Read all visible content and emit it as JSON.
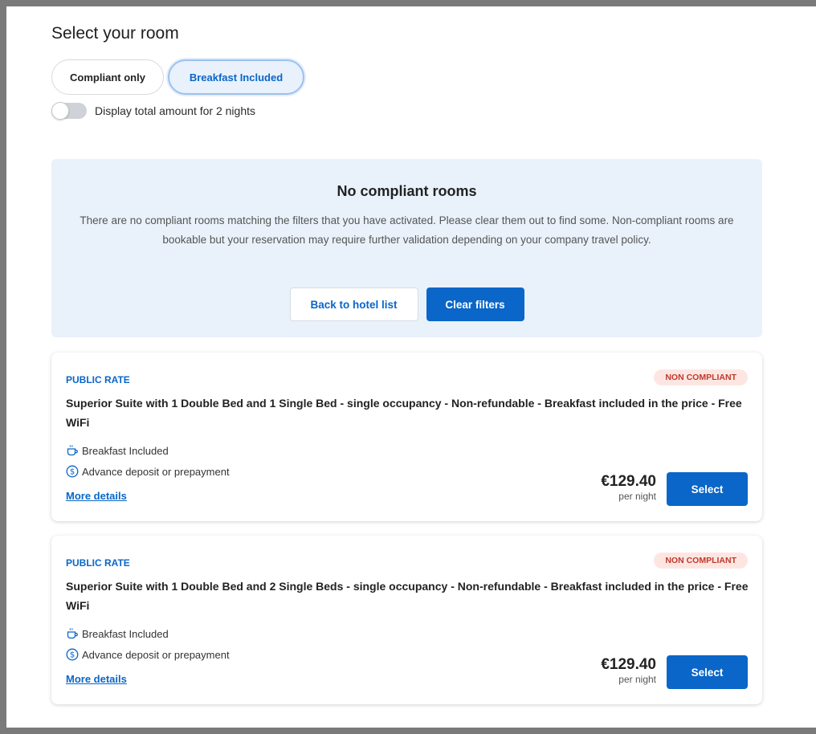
{
  "page": {
    "title": "Select your room"
  },
  "filters": {
    "compliant_only": "Compliant only",
    "breakfast_included": "Breakfast Included",
    "breakfast_included_active": true,
    "compliant_only_active": false
  },
  "total_toggle": {
    "label": "Display total amount for 2 nights",
    "on": false
  },
  "notice": {
    "title": "No compliant rooms",
    "text": "There are no compliant rooms matching the filters that you have activated. Please clear them out to find some. Non-compliant rooms are bookable but your reservation may require further validation depending on your company travel policy.",
    "back_button": "Back to hotel list",
    "clear_button": "Clear filters"
  },
  "rooms": [
    {
      "rate_type": "PUBLIC RATE",
      "badge": "NON COMPLIANT",
      "title": "Superior Suite with 1 Double Bed and 1 Single Bed - single occupancy - Non-refundable - Breakfast included in the price - Free WiFi",
      "features": [
        {
          "icon": "coffee-cup-icon",
          "label": "Breakfast Included"
        },
        {
          "icon": "dollar-circle-icon",
          "label": "Advance deposit or prepayment"
        }
      ],
      "more_details": "More details",
      "price": "€129.40",
      "price_unit": "per night",
      "select_label": "Select"
    },
    {
      "rate_type": "PUBLIC RATE",
      "badge": "NON COMPLIANT",
      "title": "Superior Suite with 1 Double Bed and 2 Single Beds - single occupancy - Non-refundable - Breakfast included in the price - Free WiFi",
      "features": [
        {
          "icon": "coffee-cup-icon",
          "label": "Breakfast Included"
        },
        {
          "icon": "dollar-circle-icon",
          "label": "Advance deposit or prepayment"
        }
      ],
      "more_details": "More details",
      "price": "€129.40",
      "price_unit": "per night",
      "select_label": "Select"
    }
  ],
  "colors": {
    "accent": "#0a66c8",
    "notice_bg": "#e9f2fb",
    "badge_bg": "#fde6e2",
    "badge_text": "#c0392b"
  }
}
